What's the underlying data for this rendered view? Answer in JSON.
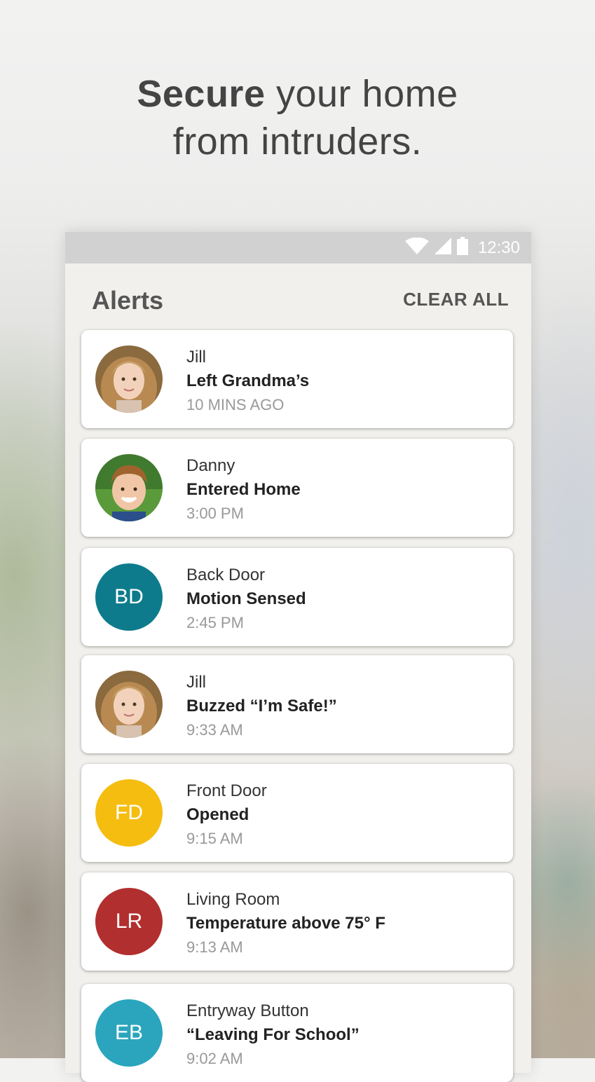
{
  "headline": {
    "bold": "Secure",
    "rest1": " your home",
    "line2": "from intruders."
  },
  "status_bar": {
    "time": "12:30",
    "icons": [
      "wifi-icon",
      "signal-icon",
      "battery-icon"
    ]
  },
  "app": {
    "title": "Alerts",
    "clear_all": "CLEAR ALL"
  },
  "alerts": [
    {
      "avatar_type": "photo",
      "avatar_icon": "girl-photo",
      "name": "Jill",
      "event": "Left Grandma’s",
      "time": "10 MINS AGO"
    },
    {
      "avatar_type": "photo",
      "avatar_icon": "boy-photo",
      "name": "Danny",
      "event": "Entered Home",
      "time": "3:00 PM"
    },
    {
      "avatar_type": "initials",
      "initials": "BD",
      "color": "#0e7b8c",
      "name": "Back Door",
      "event": "Motion Sensed",
      "time": "2:45 PM"
    },
    {
      "avatar_type": "photo",
      "avatar_icon": "girl-photo",
      "name": "Jill",
      "event": "Buzzed “I’m Safe!”",
      "time": "9:33 AM"
    },
    {
      "avatar_type": "initials",
      "initials": "FD",
      "color": "#f5bd10",
      "name": "Front Door",
      "event": "Opened",
      "time": "9:15 AM"
    },
    {
      "avatar_type": "initials",
      "initials": "LR",
      "color": "#b22f2f",
      "name": "Living Room",
      "event": "Temperature above 75° F",
      "time": "9:13 AM"
    },
    {
      "avatar_type": "initials",
      "initials": "EB",
      "color": "#2aa5bd",
      "name": "Entryway Button",
      "event": "“Leaving For School”",
      "time": "9:02 AM"
    }
  ]
}
